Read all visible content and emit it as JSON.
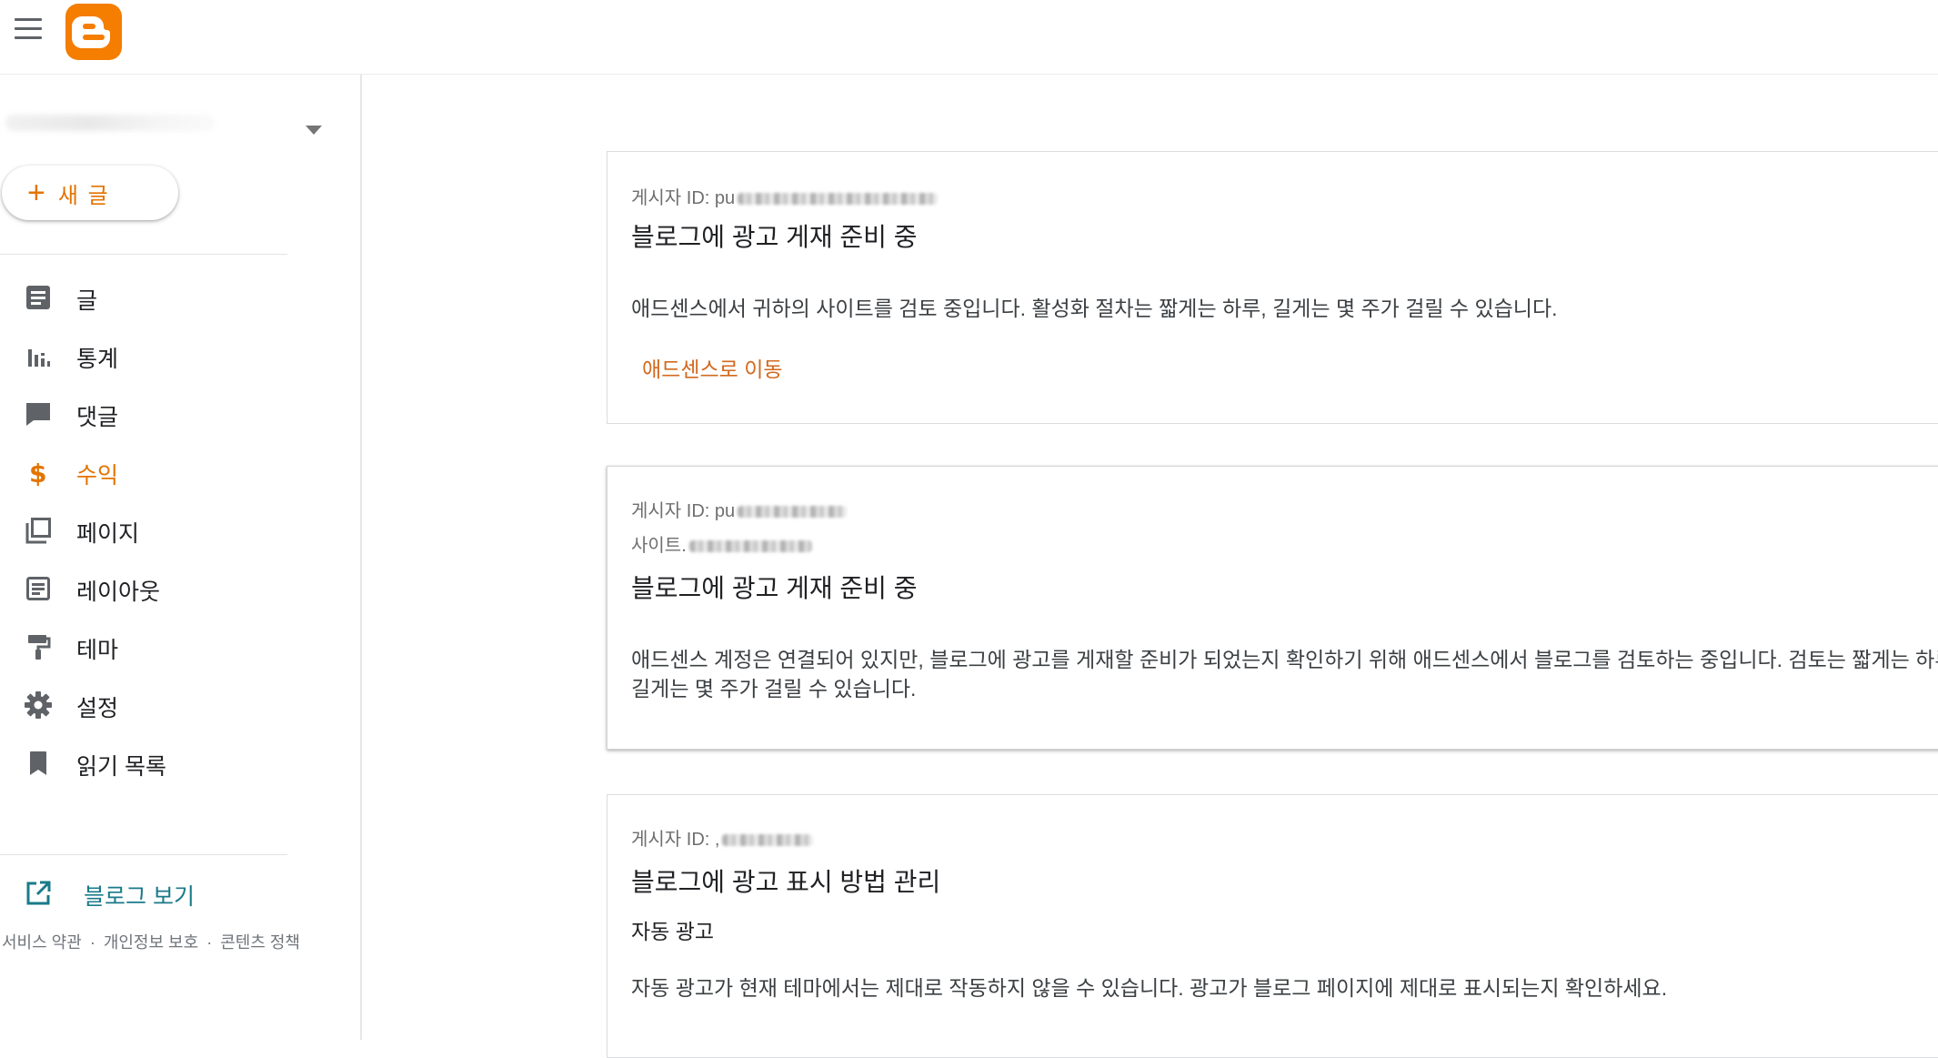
{
  "header": {
    "menu_icon": "hamburger-menu-icon",
    "logo_icon": "blogger-logo-icon",
    "brand_color": "#F57D00"
  },
  "sidebar": {
    "new_post_label": "새 글",
    "items": [
      {
        "label": "글",
        "icon": "posts-icon"
      },
      {
        "label": "통계",
        "icon": "stats-icon"
      },
      {
        "label": "댓글",
        "icon": "comment-icon"
      },
      {
        "label": "수익",
        "icon": "dollar-icon",
        "active": true
      },
      {
        "label": "페이지",
        "icon": "pages-icon"
      },
      {
        "label": "레이아웃",
        "icon": "layout-icon"
      },
      {
        "label": "테마",
        "icon": "theme-paint-roller-icon"
      },
      {
        "label": "설정",
        "icon": "gear-icon"
      },
      {
        "label": "읽기 목록",
        "icon": "bookmark-icon"
      }
    ],
    "view_blog_label": "블로그 보기",
    "footer": {
      "terms": "서비스 약관",
      "privacy": "개인정보 보호",
      "content_policy": "콘텐츠 정책",
      "separator": "·"
    },
    "accent_color": "#E37400"
  },
  "cards": [
    {
      "publisher_label": "게시자 ID: pu",
      "title": "블로그에 광고 게재 준비 중",
      "body": "애드센스에서 귀하의 사이트를 검토 중입니다. 활성화 절차는 짧게는 하루, 길게는 몇 주가 걸릴 수 있습니다.",
      "link": "애드센스로 이동"
    },
    {
      "publisher_label": "게시자 ID: pu",
      "site_label": "사이트.",
      "title": "블로그에 광고 게재 준비 중",
      "body": "애드센스 계정은 연결되어 있지만, 블로그에 광고를 게재할 준비가 되었는지 확인하기 위해 애드센스에서 블로그를 검토하는 중입니다. 검토는 짧게는 하루, 길게는 몇 주가 걸릴 수 있습니다."
    },
    {
      "publisher_label": "게시자 ID: ,",
      "title": "블로그에 광고 표시 방법 관리",
      "subheading": "자동 광고",
      "body": "자동 광고가 현재 테마에서는 제대로 작동하지 않을 수 있습니다. 광고가 블로그 페이지에 제대로 표시되는지 확인하세요."
    }
  ]
}
